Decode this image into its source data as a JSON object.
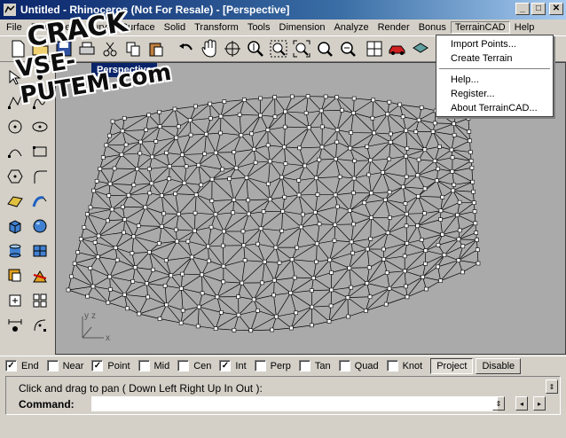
{
  "window": {
    "title": "Untitled - Rhinoceros (Not For Resale) - [Perspective]",
    "minimize": "_",
    "maximize": "□",
    "close": "✕"
  },
  "menu": [
    {
      "label": "File"
    },
    {
      "label": "Edit"
    },
    {
      "label": "View"
    },
    {
      "label": "Curve"
    },
    {
      "label": "Surface"
    },
    {
      "label": "Solid"
    },
    {
      "label": "Transform"
    },
    {
      "label": "Tools"
    },
    {
      "label": "Dimension"
    },
    {
      "label": "Analyze"
    },
    {
      "label": "Render"
    },
    {
      "label": "Bonus"
    },
    {
      "label": "TerrainCAD"
    },
    {
      "label": "Help"
    }
  ],
  "dropdown": {
    "items": [
      "Import Points...",
      "Create Terrain",
      "Help...",
      "Register...",
      "About TerrainCAD..."
    ]
  },
  "viewport": {
    "name": "Perspective",
    "axis_y": "y",
    "axis_z": "z",
    "axis_x": "x"
  },
  "osnaps": [
    {
      "label": "End",
      "checked": true,
      "check": "✓"
    },
    {
      "label": "Near",
      "checked": false,
      "check": ""
    },
    {
      "label": "Point",
      "checked": true,
      "check": "✓"
    },
    {
      "label": "Mid",
      "checked": false,
      "check": ""
    },
    {
      "label": "Cen",
      "checked": false,
      "check": ""
    },
    {
      "label": "Int",
      "checked": true,
      "check": "✓"
    },
    {
      "label": "Perp",
      "checked": false,
      "check": ""
    },
    {
      "label": "Tan",
      "checked": false,
      "check": ""
    },
    {
      "label": "Quad",
      "checked": false,
      "check": ""
    },
    {
      "label": "Knot",
      "checked": false,
      "check": ""
    }
  ],
  "osnap_buttons": {
    "project": "Project",
    "disable": "Disable"
  },
  "command": {
    "history": "Click and drag to pan ( Down  Left  Right  Up  In  Out ):",
    "prompt": "Command:",
    "input": ""
  },
  "watermark": {
    "line1": "CRACK",
    "line2": "VSE-PUTEM.com"
  },
  "colors": {
    "accent": "#0a246a",
    "viewport_bg": "#aaaaaa",
    "mesh_line": "#000000"
  },
  "toolbar_icons": [
    "new-file-icon",
    "open-icon",
    "save-icon",
    "print-icon",
    "cut-icon",
    "copy-icon",
    "paste-icon",
    "undo-icon",
    "pan-hand-icon",
    "rotate-view-icon",
    "zoom-dynamic-icon",
    "zoom-window-icon",
    "zoom-extents-icon",
    "zoom-selected-icon",
    "four-viewports-icon",
    "car-render-icon",
    "shade-icon"
  ],
  "sidebar_icons": [
    "select-icon",
    "point-icon",
    "polyline-icon",
    "curve-icon",
    "arc-icon",
    "circle-icon",
    "rectangle-icon",
    "ellipse-icon",
    "polygon-icon",
    "fillet-icon",
    "surface-icon",
    "extrude-icon",
    "box-icon",
    "sphere-icon",
    "cylinder-icon",
    "mesh-icon",
    "boolean-icon",
    "split-icon",
    "dimension-icon",
    "transform-icon",
    "array-icon",
    "group-icon",
    "analyze-icon",
    "render-icon"
  ]
}
